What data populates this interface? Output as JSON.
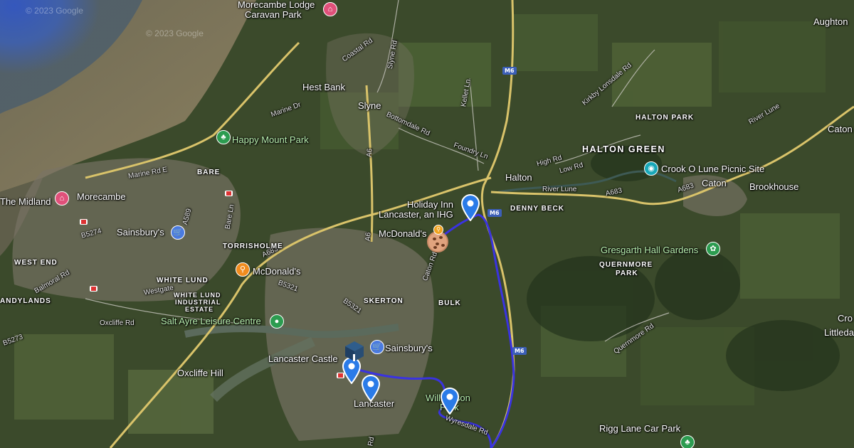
{
  "map": {
    "watermarks": [
      "© 2023 Google",
      "© 2023 Google"
    ],
    "route_color": "#3a33e0",
    "places": [
      {
        "id": "morecambe-lodge",
        "text": "Morecambe Lodge"
      },
      {
        "id": "caravan-park",
        "text": "Caravan Park"
      },
      {
        "id": "hest-bank",
        "text": "Hest Bank"
      },
      {
        "id": "slyne",
        "text": "Slyne"
      },
      {
        "id": "happy-mount-park",
        "text": "Happy Mount Park"
      },
      {
        "id": "bare",
        "text": "BARE"
      },
      {
        "id": "morecambe",
        "text": "Morecambe"
      },
      {
        "id": "the-midland",
        "text": "The Midland"
      },
      {
        "id": "sainsburys-morecambe",
        "text": "Sainsbury's"
      },
      {
        "id": "torrisholme",
        "text": "TORRISHOLME"
      },
      {
        "id": "mcdonalds-west",
        "text": "McDonald's"
      },
      {
        "id": "west-end",
        "text": "WEST END"
      },
      {
        "id": "sandylands",
        "text": "ANDYLANDS"
      },
      {
        "id": "white-lund",
        "text": "WHITE LUND"
      },
      {
        "id": "white-lund-estate-1",
        "text": "WHITE LUND"
      },
      {
        "id": "white-lund-estate-2",
        "text": "INDUSTRIAL"
      },
      {
        "id": "white-lund-estate-3",
        "text": "ESTATE"
      },
      {
        "id": "salt-ayre",
        "text": "Salt Ayre Leisure Centre"
      },
      {
        "id": "oxcliffe-hill",
        "text": "Oxcliffe Hill"
      },
      {
        "id": "lancaster-castle",
        "text": "Lancaster Castle"
      },
      {
        "id": "lancaster",
        "text": "Lancaster"
      },
      {
        "id": "sainsburys-lancaster",
        "text": "Sainsbury's"
      },
      {
        "id": "skerton",
        "text": "SKERTON"
      },
      {
        "id": "bulk",
        "text": "BULK"
      },
      {
        "id": "holiday-inn-1",
        "text": "Holiday Inn"
      },
      {
        "id": "holiday-inn-2",
        "text": "Lancaster, an IHG"
      },
      {
        "id": "mcdonalds-east",
        "text": "McDonald's"
      },
      {
        "id": "williamson-1",
        "text": "Williamson"
      },
      {
        "id": "williamson-2",
        "text": "Park"
      },
      {
        "id": "halton",
        "text": "Halton"
      },
      {
        "id": "halton-green",
        "text": "HALTON GREEN"
      },
      {
        "id": "halton-park",
        "text": "HALTON PARK"
      },
      {
        "id": "denny-beck",
        "text": "DENNY BECK"
      },
      {
        "id": "crook-o-lune",
        "text": "Crook O Lune Picnic Site"
      },
      {
        "id": "caton",
        "text": "Caton"
      },
      {
        "id": "caton-east",
        "text": "Caton"
      },
      {
        "id": "brookhouse",
        "text": "Brookhouse"
      },
      {
        "id": "aughton",
        "text": "Aughton"
      },
      {
        "id": "gresgarth",
        "text": "Gresgarth Hall Gardens"
      },
      {
        "id": "quernmore-1",
        "text": "QUERNMORE"
      },
      {
        "id": "quernmore-2",
        "text": "PARK"
      },
      {
        "id": "rigg-lane",
        "text": "Rigg Lane Car Park"
      },
      {
        "id": "cro",
        "text": "Cro"
      },
      {
        "id": "littledale",
        "text": "Littleda"
      }
    ],
    "roads": [
      {
        "id": "coastal-rd",
        "text": "Coastal Rd"
      },
      {
        "id": "slyne-rd",
        "text": "Slyne Rd"
      },
      {
        "id": "marine-dr",
        "text": "Marine Dr"
      },
      {
        "id": "bottomdale-rd",
        "text": "Bottomdale Rd"
      },
      {
        "id": "marine-rd-e",
        "text": "Marine Rd E"
      },
      {
        "id": "a6-north",
        "text": "A6"
      },
      {
        "id": "a6-south",
        "text": "A6"
      },
      {
        "id": "foundry-ln",
        "text": "Foundry Ln"
      },
      {
        "id": "kellet-ln",
        "text": "Kellet Ln"
      },
      {
        "id": "kirkby-lonsdale-rd",
        "text": "Kirkby Lonsdale Rd"
      },
      {
        "id": "high-rd",
        "text": "High Rd"
      },
      {
        "id": "low-rd",
        "text": "Low Rd"
      },
      {
        "id": "river-lune",
        "text": "River Lune"
      },
      {
        "id": "river-lune-east",
        "text": "River Lune"
      },
      {
        "id": "a683-east",
        "text": "A683"
      },
      {
        "id": "a683-caton",
        "text": "A683"
      },
      {
        "id": "a683-west",
        "text": "A683"
      },
      {
        "id": "a589",
        "text": "A589"
      },
      {
        "id": "bare-ln",
        "text": "Bare Ln"
      },
      {
        "id": "b5274",
        "text": "B5274"
      },
      {
        "id": "balmoral-rd",
        "text": "Balmoral Rd"
      },
      {
        "id": "westgate",
        "text": "Westgate"
      },
      {
        "id": "b5321-north",
        "text": "B5321"
      },
      {
        "id": "b5321-south",
        "text": "B5321"
      },
      {
        "id": "oxcliffe-rd",
        "text": "Oxcliffe Rd"
      },
      {
        "id": "b5273",
        "text": "B5273"
      },
      {
        "id": "caton-rd",
        "text": "Caton Rd"
      },
      {
        "id": "quernmore-rd",
        "text": "Quernmore Rd"
      },
      {
        "id": "wyresdale-rd",
        "text": "Wyresdale Rd"
      },
      {
        "id": "rd-south",
        "text": "Rd"
      }
    ],
    "motorway_shields": [
      "M6",
      "M6",
      "M6"
    ]
  }
}
